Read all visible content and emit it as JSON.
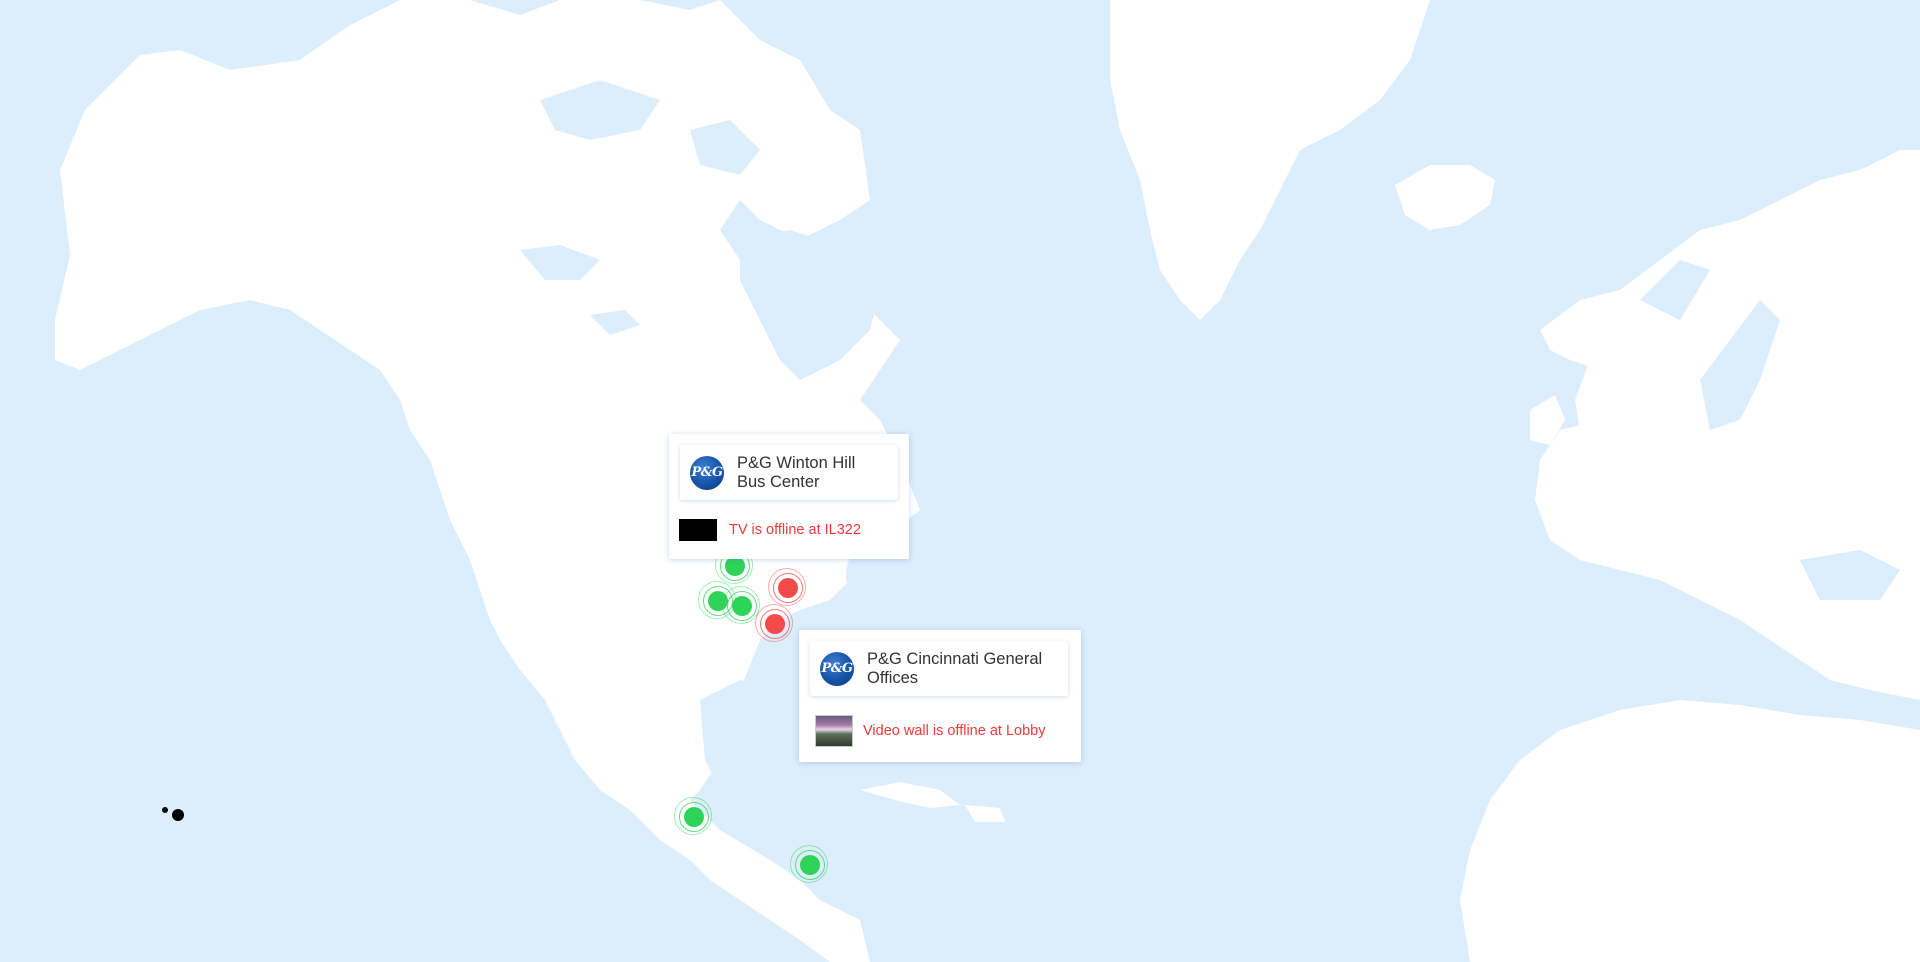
{
  "colors": {
    "water": "#dcedfb",
    "land": "#ffffff",
    "online": "#2ed457",
    "offline": "#f54a4a",
    "alert_text": "#f03a3a"
  },
  "markers": [
    {
      "id": "m1",
      "status": "online"
    },
    {
      "id": "m2",
      "status": "online"
    },
    {
      "id": "m3",
      "status": "online"
    },
    {
      "id": "m4",
      "status": "offline"
    },
    {
      "id": "m5",
      "status": "offline"
    },
    {
      "id": "m6",
      "status": "online"
    },
    {
      "id": "m7",
      "status": "online"
    }
  ],
  "popups": {
    "winton": {
      "logo_text": "P&G",
      "site_name_line1": "P&G Winton Hill",
      "site_name_line2": "Bus Center",
      "alert_text": "TV is offline at IL322",
      "thumbnail": "tv-thumbnail"
    },
    "cincinnati": {
      "logo_text": "P&G",
      "site_name_line1": "P&G Cincinnati General",
      "site_name_line2": "Offices",
      "alert_text": "Video wall is offline at Lobby",
      "thumbnail": "video-wall-thumbnail"
    }
  }
}
